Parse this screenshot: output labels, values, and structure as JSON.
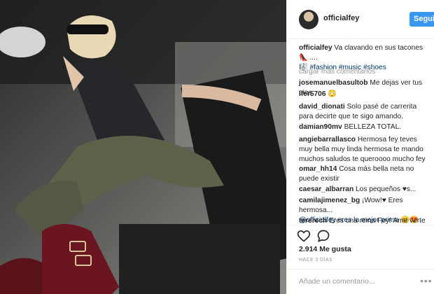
{
  "post": {
    "username": "officialfey",
    "follow_label": "Seguir",
    "caption_user": "officialfey",
    "caption_text": "Va clavando en sus tacones 👠 ....",
    "caption_tags": "🎼 #fashion #music #shoes",
    "load_more": "cargar más comentarios",
    "likes": "2.914 Me gusta",
    "time": "HACE 3 DÍAS",
    "add_comment_placeholder": "Añade un comentario...",
    "more_options": "•••"
  },
  "comments": [
    {
      "user": "josemanuelbasultob",
      "text": "Me dejas ver tus pies"
    },
    {
      "user": "lfer5706",
      "text": "😳"
    },
    {
      "user": "david_dionati",
      "text": "Solo pasé de carrerita para decirte que te sigo amando."
    },
    {
      "user": "damian90mv",
      "text": "BELLEZA TOTAL."
    },
    {
      "user": "angiebarrallasco",
      "text": "Hermosa fey teves muy bella muy linda hermosa te mando muchos saludos te queroooo mucho fey"
    },
    {
      "user": "omar_hh14",
      "text": "Cosa más bella neta no puede existir"
    },
    {
      "user": "caesar_albarran",
      "text": "Los pequeños ♥s..."
    },
    {
      "user": "camilajimenez_bg",
      "text": "¡Wow!♥ Eres hermosa..."
    },
    {
      "user": "",
      "text": "@officialfey eres la mejor prima 😊😍"
    },
    {
      "user": "tererech",
      "text": "Eres una reina Fey! Ame verte en"
    }
  ],
  "icons": {
    "heart": "heart-icon",
    "comment": "comment-icon"
  },
  "colors": {
    "follow_button": "#3897f0",
    "hashtag": "#003569",
    "muted": "#999999"
  }
}
